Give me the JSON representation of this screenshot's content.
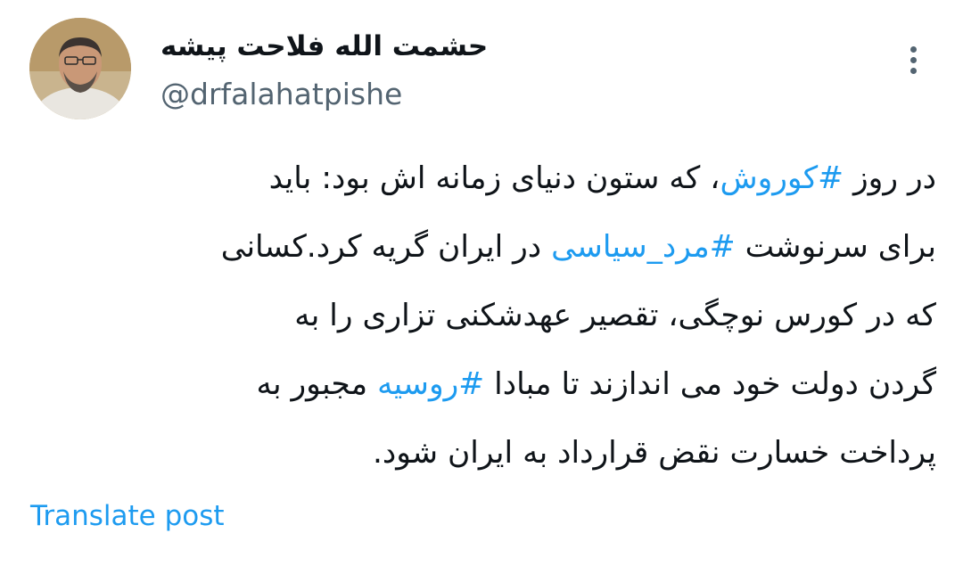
{
  "author": {
    "display_name": "حشمت الله فلاحت پیشه",
    "handle": "@drfalahatpishe",
    "avatar": "profile-photo"
  },
  "actions": {
    "more_icon": "vertical-ellipsis-icon"
  },
  "tweet": {
    "lines": [
      [
        {
          "text": "در روز ",
          "type": "text"
        },
        {
          "text": "#کوروش",
          "type": "hashtag"
        },
        {
          "text": "، که ستون دنیای زمانه اش بود: باید",
          "type": "text"
        }
      ],
      [
        {
          "text": "برای سرنوشت ",
          "type": "text"
        },
        {
          "text": "#مرد_سیاسی",
          "type": "hashtag"
        },
        {
          "text": " در ایران گریه کرد.کسانی",
          "type": "text"
        }
      ],
      [
        {
          "text": "که در کورس نوچگی، تقصیر عهدشکنی تزاری را به",
          "type": "text"
        }
      ],
      [
        {
          "text": "گردن دولت خود می اندازند تا مبادا ",
          "type": "text"
        },
        {
          "text": "#روسیه",
          "type": "hashtag"
        },
        {
          "text": " مجبور به",
          "type": "text"
        }
      ],
      [
        {
          "text": "پرداخت خسارت نقض قرارداد به ایران شود.",
          "type": "text"
        }
      ]
    ]
  },
  "translate": {
    "label": "Translate post"
  },
  "colors": {
    "link": "#1d9bf0",
    "text": "#0f1419",
    "secondary": "#536471"
  }
}
